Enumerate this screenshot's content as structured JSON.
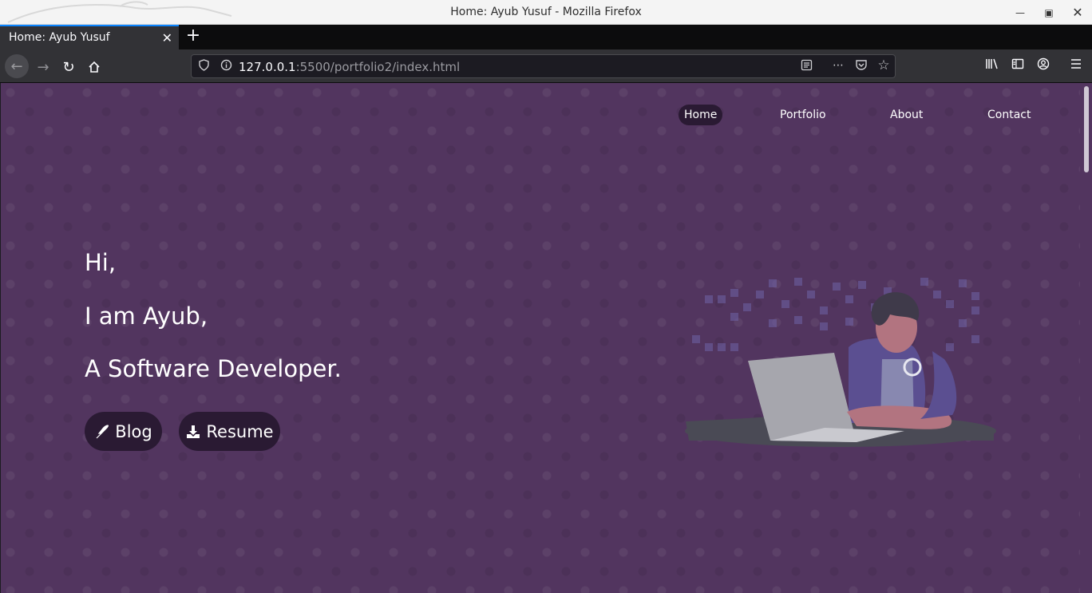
{
  "window": {
    "title": "Home: Ayub Yusuf - Mozilla Firefox"
  },
  "tabs": [
    {
      "label": "Home: Ayub Yusuf"
    }
  ],
  "urlbar": {
    "host": "127.0.0.1",
    "path": ":5500/portfolio2/index.html"
  },
  "site": {
    "nav": [
      "Home",
      "Portfolio",
      "About",
      "Contact"
    ],
    "active_nav": "Home",
    "hero": {
      "line1": "Hi,",
      "line2": "I am Ayub,",
      "line3": "A Software Developer."
    },
    "buttons": {
      "blog": "Blog",
      "resume": "Resume"
    }
  },
  "colors": {
    "page_background": "#52355f",
    "button_background": "#2a1a33",
    "tab_accent": "#0a84ff"
  },
  "icons": {
    "blog": "feather-icon",
    "resume": "download-icon"
  }
}
